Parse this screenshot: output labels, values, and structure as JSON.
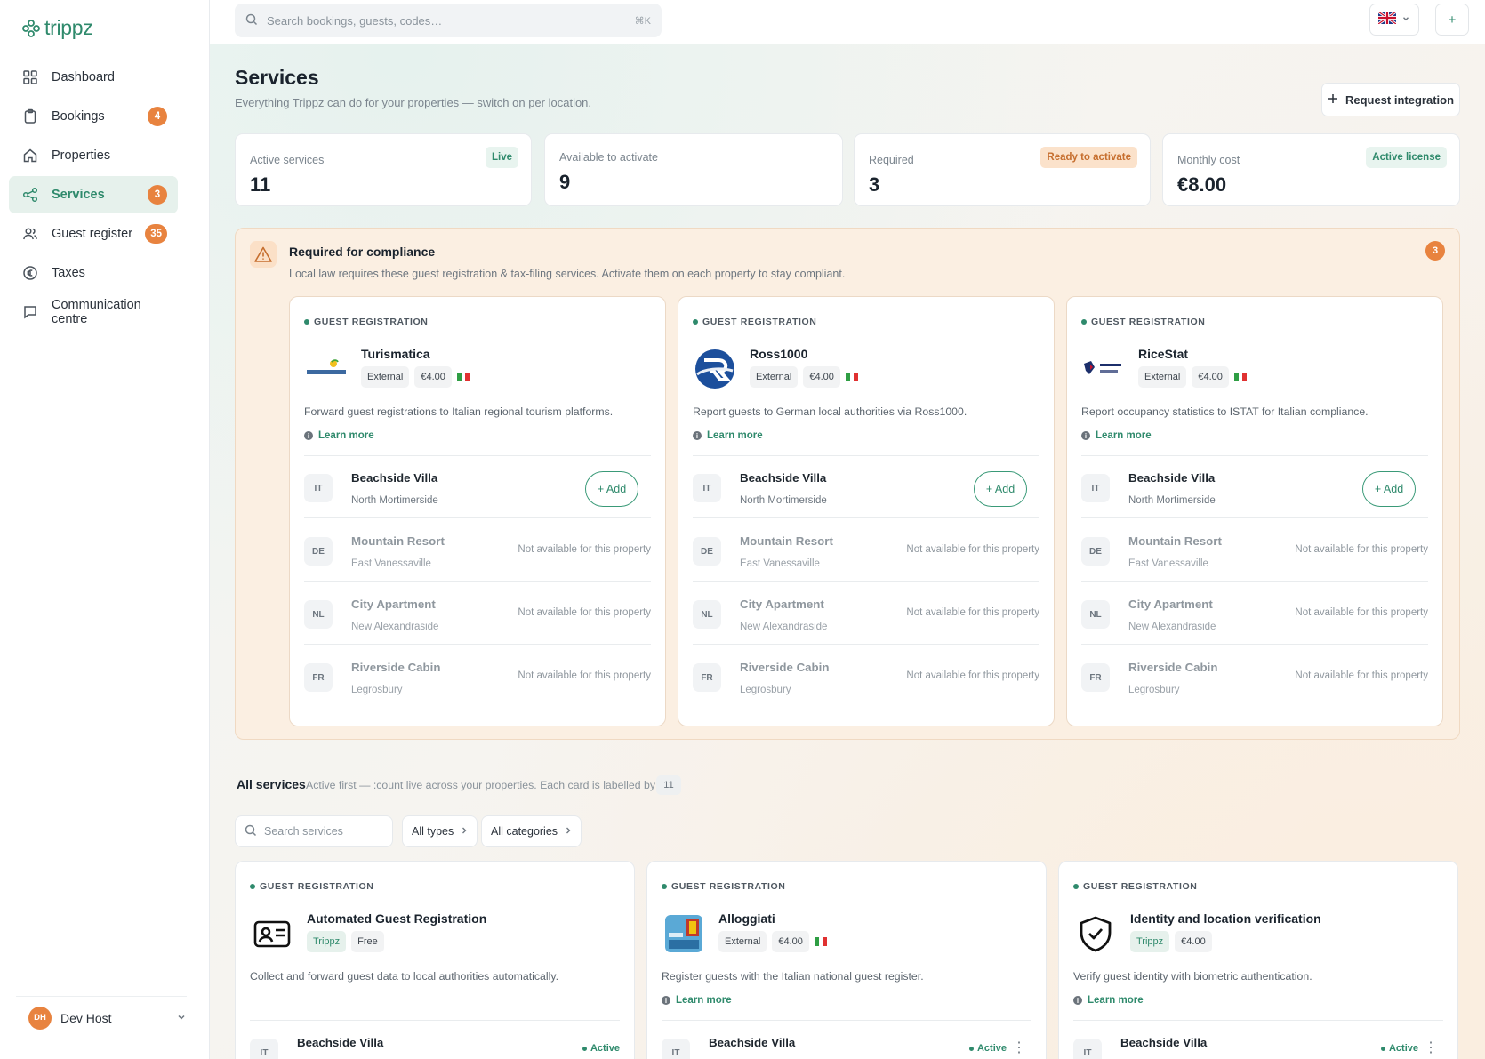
{
  "app": {
    "name": "trippz"
  },
  "sidebar": {
    "items": [
      {
        "label": "Dashboard",
        "icon": "dashboard-icon"
      },
      {
        "label": "Bookings",
        "icon": "clipboard-icon",
        "badge": "4"
      },
      {
        "label": "Properties",
        "icon": "home-icon"
      },
      {
        "label": "Services",
        "icon": "share-icon",
        "badge": "3",
        "active": true
      },
      {
        "label": "Guest register",
        "icon": "users-icon",
        "badge": "35"
      },
      {
        "label": "Taxes",
        "icon": "euro-icon"
      },
      {
        "label": "Communication centre",
        "icon": "chat-icon"
      }
    ],
    "user": {
      "initials": "DH",
      "name": "Dev Host"
    }
  },
  "topbar": {
    "search_placeholder": "Search bookings, guests, codes…",
    "search_shortcut": "⌘K",
    "add_label": "+"
  },
  "page": {
    "title": "Services",
    "subtitle": "Everything Trippz can do for your properties — switch on per location.",
    "request_button": "Request integration"
  },
  "stats": [
    {
      "label": "Active services",
      "value": "11",
      "tag": "Live",
      "tag_style": "green"
    },
    {
      "label": "Available to activate",
      "value": "9",
      "tag": ""
    },
    {
      "label": "Required",
      "value": "3",
      "tag": "Ready to activate",
      "tag_style": "orange"
    },
    {
      "label": "Monthly cost",
      "value": "€8.00",
      "tag": "Active license",
      "tag_style": "green"
    }
  ],
  "compliance": {
    "title": "Required for compliance",
    "subtitle": "Local law requires these guest registration & tax-filing services. Activate them on each property to stay compliant.",
    "count": "3",
    "cards": [
      {
        "type": "GUEST REGISTRATION",
        "name": "Turismatica",
        "tags": [
          "External",
          "€4.00"
        ],
        "desc": "Forward guest registrations to Italian regional tourism platforms.",
        "learn": "Learn more"
      },
      {
        "type": "GUEST REGISTRATION",
        "name": "Ross1000",
        "tags": [
          "External",
          "€4.00"
        ],
        "desc": "Report guests to German local authorities via Ross1000.",
        "learn": "Learn more"
      },
      {
        "type": "GUEST REGISTRATION",
        "name": "RiceStat",
        "tags": [
          "External",
          "€4.00"
        ],
        "desc": "Report occupancy statistics to ISTAT for Italian compliance.",
        "learn": "Learn more"
      }
    ]
  },
  "properties": [
    {
      "code": "IT",
      "name": "Beachside Villa",
      "location": "North Mortimerside"
    },
    {
      "code": "DE",
      "name": "Mountain Resort",
      "location": "East Vanessaville"
    },
    {
      "code": "NL",
      "name": "City Apartment",
      "location": "New Alexandraside"
    },
    {
      "code": "FR",
      "name": "Riverside Cabin",
      "location": "Legrosbury"
    }
  ],
  "labels": {
    "add": "+ Add",
    "not_available": "Not available for this property",
    "active": "Active"
  },
  "all_services": {
    "title": "All services",
    "subtitle": "Active first — :count live across your properties. Each card is labelled by type.",
    "count": "11",
    "search_placeholder": "Search services",
    "type_filter": "All types",
    "category_filter": "All categories",
    "cards": [
      {
        "type": "GUEST REGISTRATION",
        "name": "Automated Guest Registration",
        "tags": [
          "Trippz",
          "Free"
        ],
        "desc": "Collect and forward guest data to local authorities automatically."
      },
      {
        "type": "GUEST REGISTRATION",
        "name": "Alloggiati",
        "tags": [
          "External",
          "€4.00"
        ],
        "desc": "Register guests with the Italian national guest register.",
        "learn": "Learn more"
      },
      {
        "type": "GUEST REGISTRATION",
        "name": "Identity and location verification",
        "tags": [
          "Trippz",
          "€4.00"
        ],
        "desc": "Verify guest identity with biometric authentication.",
        "learn": "Learn more"
      }
    ]
  },
  "colors": {
    "brand": "#2f8a6c",
    "badge": "#e8833f",
    "compliance_bg": "#fbefe2"
  }
}
